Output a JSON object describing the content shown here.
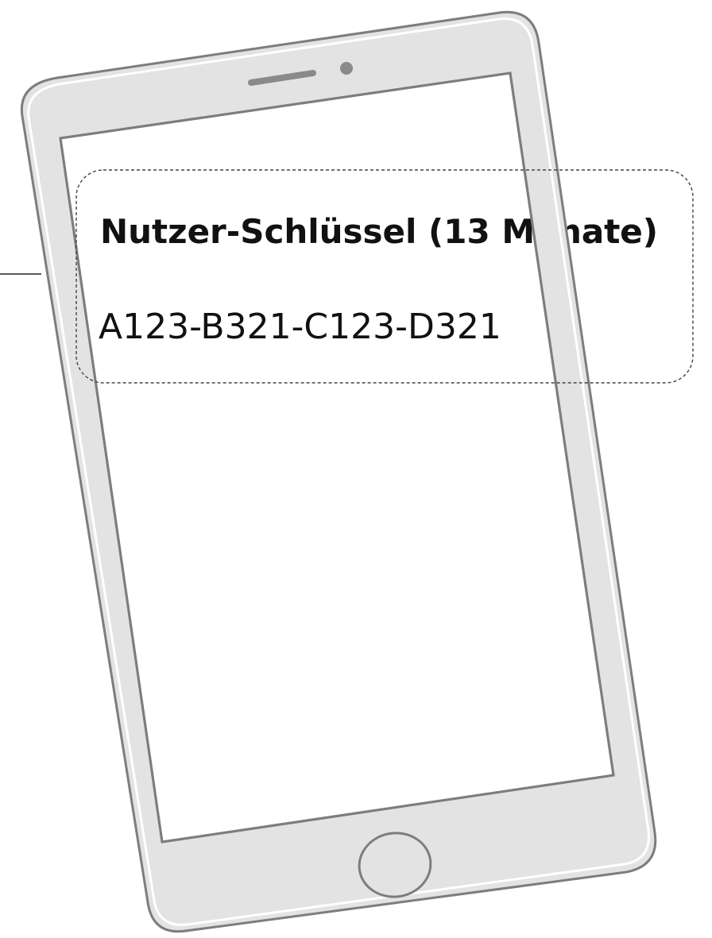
{
  "device": {
    "frame_color": "#e3e3e3",
    "frame_stroke": "#7d7d7d",
    "screen_color": "#ffffff",
    "speaker_color": "#8a8a8a",
    "camera_color": "#8a8a8a",
    "home_button_color": "#e3e3e3"
  },
  "callout": {
    "border_color": "#444444",
    "line_color": "#222222",
    "title": "Nutzer-Schlüssel (13 Monate)",
    "key_value": "A123-B321-C123-D321"
  }
}
